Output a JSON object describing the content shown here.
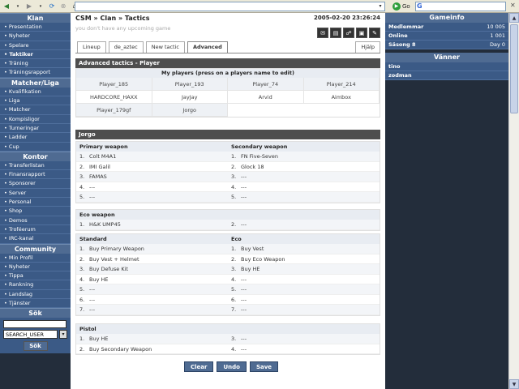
{
  "browser": {
    "go_label": "Go"
  },
  "left": {
    "sections": [
      {
        "title": "Klan",
        "items": [
          {
            "label": "• Presentation",
            "bold": false
          },
          {
            "label": "• Nyheter",
            "bold": false
          },
          {
            "label": "• Spelare",
            "bold": false
          },
          {
            "label": "• Taktiker",
            "bold": true
          },
          {
            "label": "• Träning",
            "bold": false
          },
          {
            "label": "• Träningsrapport",
            "bold": false
          }
        ]
      },
      {
        "title": "Matcher/Liga",
        "items": [
          {
            "label": "• Kvalifikation"
          },
          {
            "label": "• Liga"
          },
          {
            "label": "• Matcher"
          },
          {
            "label": "• Kompisligor"
          },
          {
            "label": "• Turneringar"
          },
          {
            "label": "• Ladder"
          },
          {
            "label": "• Cup"
          }
        ]
      },
      {
        "title": "Kontor",
        "items": [
          {
            "label": "• Transferlistan"
          },
          {
            "label": "• Finansrapport"
          },
          {
            "label": "• Sponsorer"
          },
          {
            "label": "• Server"
          },
          {
            "label": "• Personal"
          },
          {
            "label": "• Shop"
          },
          {
            "label": "• Demos"
          },
          {
            "label": "• Troféerum"
          },
          {
            "label": "• IRC-kanal"
          }
        ]
      },
      {
        "title": "Community",
        "items": [
          {
            "label": "• Min Profil"
          },
          {
            "label": "• Nyheter"
          },
          {
            "label": "• Tippa"
          },
          {
            "label": "• Rankning"
          },
          {
            "label": "• Landslag"
          },
          {
            "label": "• Tjänster"
          }
        ]
      }
    ],
    "search": {
      "title": "Sök",
      "select_value": "SEARCH_USER",
      "button": "Sök"
    }
  },
  "center": {
    "breadcrumb": "CSM » Clan » Tactics",
    "datetime": "2005-02-20 23:26:24",
    "upcoming": "you don't have any upcoming game",
    "tabs": [
      "Lineup",
      "de_aztec",
      "New tactic",
      "Advanced"
    ],
    "help_tab": "Hjälp",
    "advanced_title": "Advanced tactics - Player",
    "players_subhead": "My players (press on a players name to edit)",
    "players": [
      "Player_185",
      "Player_193",
      "Player_74",
      "Player_214",
      "HARDCORE_HAXX",
      "JayJay",
      "Arvid",
      "Aimbox",
      "Player_179gf",
      "Jorgo"
    ],
    "selected_player": "Jorgo",
    "primary": {
      "title": "Primary weapon",
      "rows": [
        [
          "1.",
          "Colt M4A1"
        ],
        [
          "2.",
          "IMI Galil"
        ],
        [
          "3.",
          "FAMAS"
        ],
        [
          "4.",
          "---"
        ],
        [
          "5.",
          "---"
        ]
      ]
    },
    "secondary": {
      "title": "Secondary weapon",
      "rows": [
        [
          "1.",
          "FN Five-Seven"
        ],
        [
          "2.",
          "Glock 18"
        ],
        [
          "3.",
          "---"
        ],
        [
          "4.",
          "---"
        ],
        [
          "5.",
          "---"
        ]
      ]
    },
    "eco_weapon": {
      "title": "Eco weapon",
      "left": [
        [
          "1.",
          "H&K UMP45"
        ]
      ],
      "right": [
        [
          "2.",
          "---"
        ]
      ]
    },
    "standard": {
      "title": "Standard",
      "rows": [
        [
          "1.",
          "Buy Primary Weapon"
        ],
        [
          "2.",
          "Buy Vest + Helmet"
        ],
        [
          "3.",
          "Buy Defuse Kit"
        ],
        [
          "4.",
          "Buy HE"
        ],
        [
          "5.",
          "---"
        ],
        [
          "6.",
          "---"
        ],
        [
          "7.",
          "---"
        ]
      ]
    },
    "eco": {
      "title": "Eco",
      "rows": [
        [
          "1.",
          "Buy Vest"
        ],
        [
          "2.",
          "Buy Eco Weapon"
        ],
        [
          "3.",
          "Buy HE"
        ],
        [
          "4.",
          "---"
        ],
        [
          "5.",
          "---"
        ],
        [
          "6.",
          "---"
        ],
        [
          "7.",
          "---"
        ]
      ]
    },
    "pistol": {
      "title": "Pistol",
      "left": [
        [
          "1.",
          "Buy HE"
        ],
        [
          "2.",
          "Buy Secondary Weapon"
        ]
      ],
      "right": [
        [
          "3.",
          "---"
        ],
        [
          "4.",
          "---"
        ]
      ]
    },
    "actions": [
      "Clear",
      "Undo",
      "Save"
    ]
  },
  "right": {
    "gameinfo_title": "Gameinfo",
    "gameinfo": [
      [
        "Medlemmar",
        "10 005"
      ],
      [
        "Online",
        "1 001"
      ],
      [
        "Säsong 8",
        "Day 0"
      ]
    ],
    "friends_title": "Vänner",
    "friends": [
      "tino",
      "zodman"
    ]
  }
}
